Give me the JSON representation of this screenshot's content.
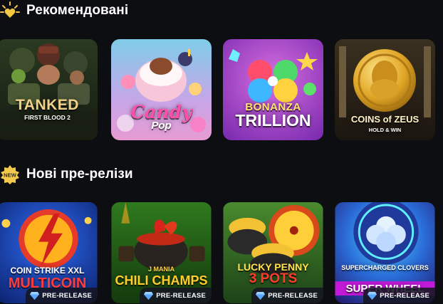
{
  "sections": [
    {
      "title": "Рекомендовані",
      "icon": "sparkle-heart-icon",
      "games": [
        {
          "line1": "TANKED",
          "line2": "FIRST BLOOD 2",
          "badge": ""
        },
        {
          "line1": "Candy",
          "line2": "Pop",
          "badge": ""
        },
        {
          "line1": "BONANZA",
          "line2": "TRILLION",
          "badge": ""
        },
        {
          "line1": "COINS of ZEUS",
          "line2": "HOLD & WIN",
          "badge": ""
        }
      ]
    },
    {
      "title": "Нові пре-релізи",
      "icon": "new-badge-icon",
      "games": [
        {
          "line1": "COIN STRIKE XXL",
          "line2": "MULTICOIN",
          "badge": "PRE-RELEASE"
        },
        {
          "line1": "J MANIA",
          "line2": "CHILI CHAMPS",
          "badge": "PRE-RELEASE"
        },
        {
          "line1": "LUCKY PENNY",
          "line2": "3 POTS",
          "badge": "PRE-RELEASE"
        },
        {
          "line1": "SUPERCHARGED CLOVERS",
          "line2": "SUPER WHEEL",
          "badge": "PRE-RELEASE"
        }
      ]
    }
  ],
  "colors": {
    "background": "#0d0e12",
    "accent_gold": "#f5c53a",
    "badge_bg": "#161622"
  }
}
